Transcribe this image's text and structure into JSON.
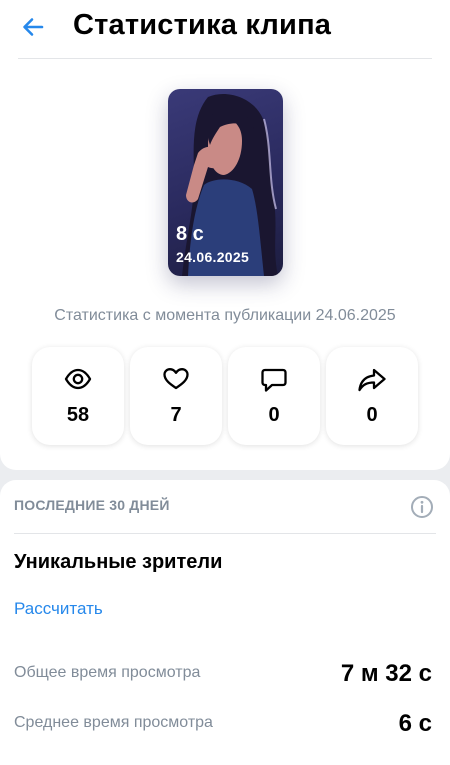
{
  "header": {
    "title": "Статистика клипа",
    "back_icon": "arrow-left-icon"
  },
  "colors": {
    "accent": "#2688eb",
    "secondary_text": "#818c99",
    "background": "#ebedf0"
  },
  "clip": {
    "duration": "8 с",
    "date": "24.06.2025"
  },
  "since_text": "Статистика с момента публикации 24.06.2025",
  "stats": [
    {
      "icon": "eye-icon",
      "value": "58"
    },
    {
      "icon": "heart-icon",
      "value": "7"
    },
    {
      "icon": "comment-icon",
      "value": "0"
    },
    {
      "icon": "share-icon",
      "value": "0"
    }
  ],
  "last_days": {
    "header": "ПОСЛЕДНИЕ 30 ДНЕЙ",
    "info_icon": "info-icon",
    "unique_title": "Уникальные зрители",
    "calc_link": "Рассчитать",
    "metrics": [
      {
        "label": "Общее время просмотра",
        "value": "7 м 32 с"
      },
      {
        "label": "Среднее время просмотра",
        "value": "6 с"
      }
    ]
  }
}
